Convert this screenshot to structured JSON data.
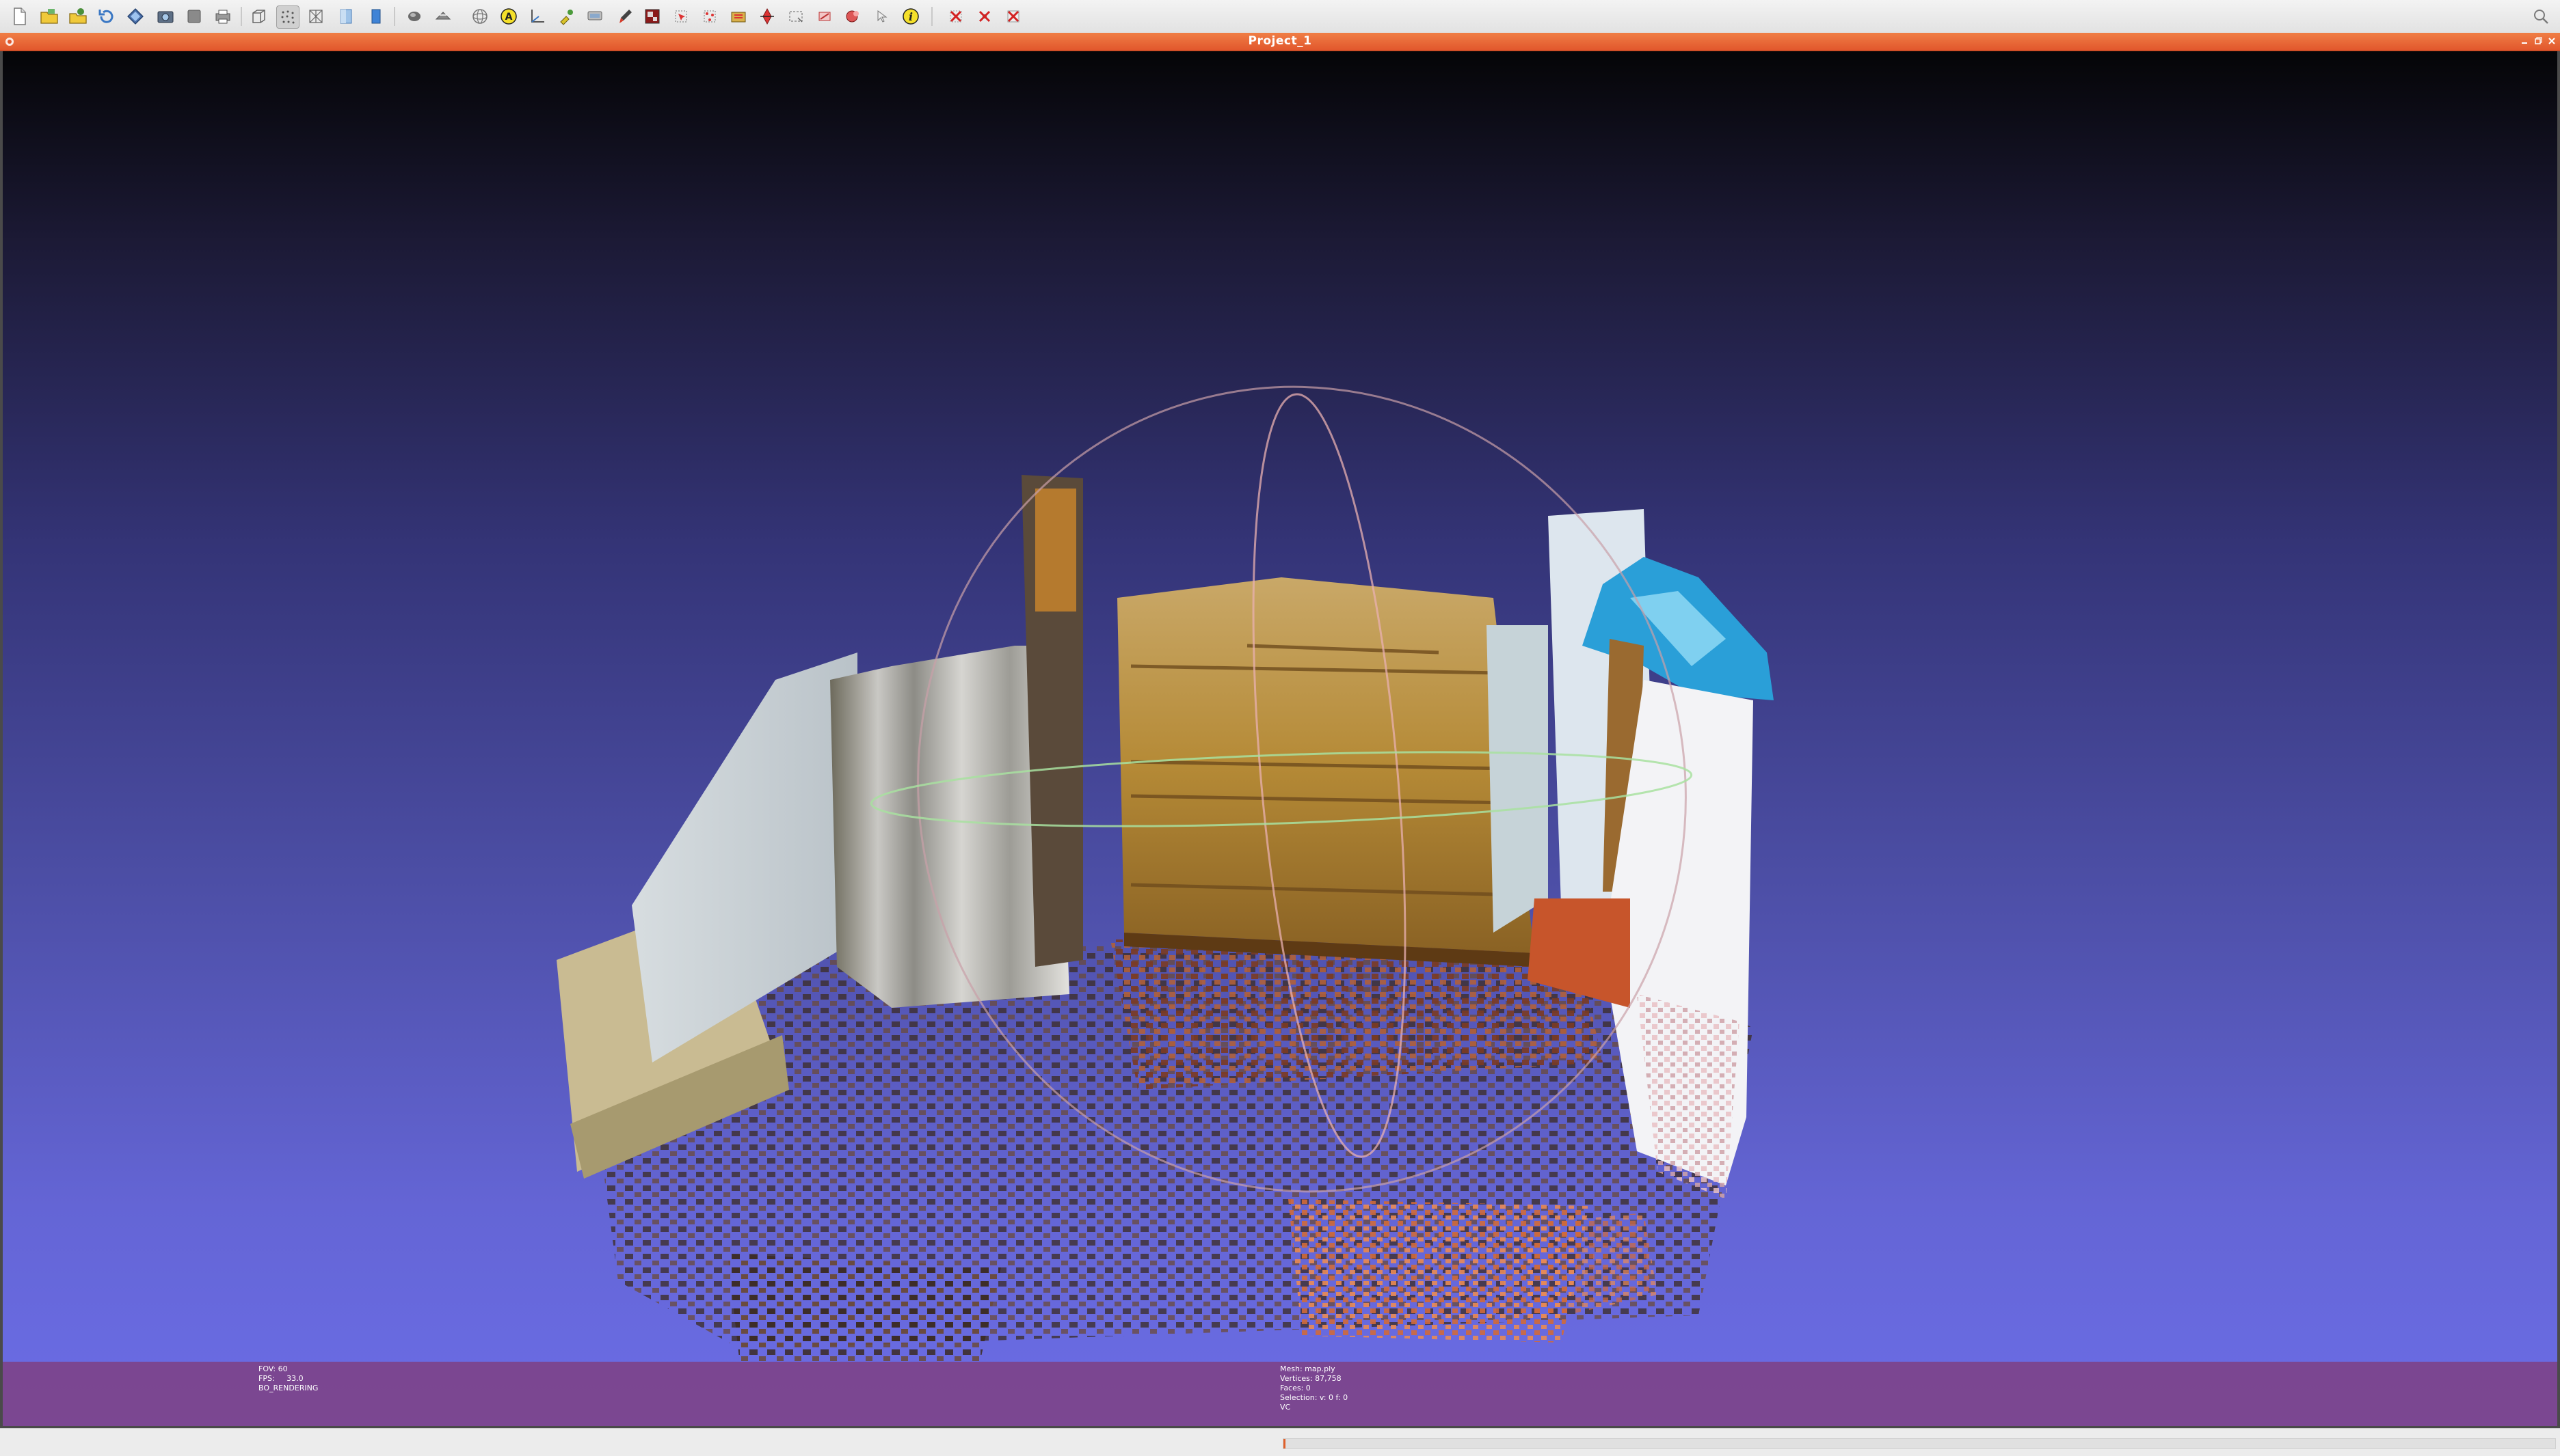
{
  "window": {
    "title": "Project_1"
  },
  "toolbar": {
    "buttons": [
      {
        "name": "new-project-button",
        "icon": "new-document-icon"
      },
      {
        "name": "open-project-button",
        "icon": "open-folder-icon"
      },
      {
        "name": "import-mesh-button",
        "icon": "import-mesh-icon"
      },
      {
        "name": "reload-button",
        "icon": "reload-icon"
      },
      {
        "name": "export-mesh-button",
        "icon": "export-mesh-icon"
      },
      {
        "name": "snapshot-button",
        "icon": "camera-icon"
      },
      {
        "name": "layer-button",
        "icon": "layer-icon"
      },
      {
        "name": "print-button",
        "icon": "print-icon"
      },
      {
        "name": "bbox-button",
        "icon": "bounding-box-icon"
      },
      {
        "name": "points-button",
        "icon": "points-render-icon"
      },
      {
        "name": "wireframe-button",
        "icon": "wireframe-icon"
      },
      {
        "name": "flat-shading-button",
        "icon": "flat-shading-icon"
      },
      {
        "name": "smooth-shading-button",
        "icon": "smooth-shading-icon"
      },
      {
        "name": "lighting-button",
        "icon": "light-icon"
      },
      {
        "name": "backface-button",
        "icon": "backface-icon"
      },
      {
        "name": "trackball-button",
        "icon": "trackball-icon"
      },
      {
        "name": "annotation-button",
        "icon": "annotation-a-icon"
      },
      {
        "name": "measure-button",
        "icon": "ruler-icon"
      },
      {
        "name": "pick-points-button",
        "icon": "pick-points-icon"
      },
      {
        "name": "align-button",
        "icon": "align-icon"
      },
      {
        "name": "paint-button",
        "icon": "brush-icon"
      },
      {
        "name": "texture-button",
        "icon": "texture-icon"
      },
      {
        "name": "select-faces-button",
        "icon": "select-faces-icon"
      },
      {
        "name": "select-vertices-button",
        "icon": "select-vertices-icon"
      },
      {
        "name": "select-connected-button",
        "icon": "select-connected-icon"
      },
      {
        "name": "manipulator-button",
        "icon": "manipulator-icon"
      },
      {
        "name": "select-rect-button",
        "icon": "select-rect-icon"
      },
      {
        "name": "z-painting-button",
        "icon": "z-painting-icon"
      },
      {
        "name": "select-color-button",
        "icon": "select-color-icon"
      },
      {
        "name": "dragging-button",
        "icon": "drag-icon"
      },
      {
        "name": "info-button",
        "icon": "info-icon"
      },
      {
        "name": "delete-faces-button",
        "icon": "delete-faces-icon"
      },
      {
        "name": "delete-vertices-button",
        "icon": "delete-vertices-icon"
      },
      {
        "name": "delete-all-button",
        "icon": "delete-all-icon"
      }
    ],
    "search_icon": "search-icon"
  },
  "viewport": {
    "info_left": {
      "fov": "FOV: 60",
      "fps": "FPS:     33.0",
      "render_mode": "BO_RENDERING"
    },
    "info_center": {
      "mesh": "Mesh: map.ply",
      "vertices": "Vertices: 87,758",
      "faces": "Faces: 0",
      "selection": "Selection: v: 0 f: 0",
      "vc": "VC"
    }
  },
  "colors": {
    "titlebar": "#e8612f",
    "background_top": "#050507",
    "background_bottom": "#6b6de6",
    "info_bar": "#803c7a"
  }
}
